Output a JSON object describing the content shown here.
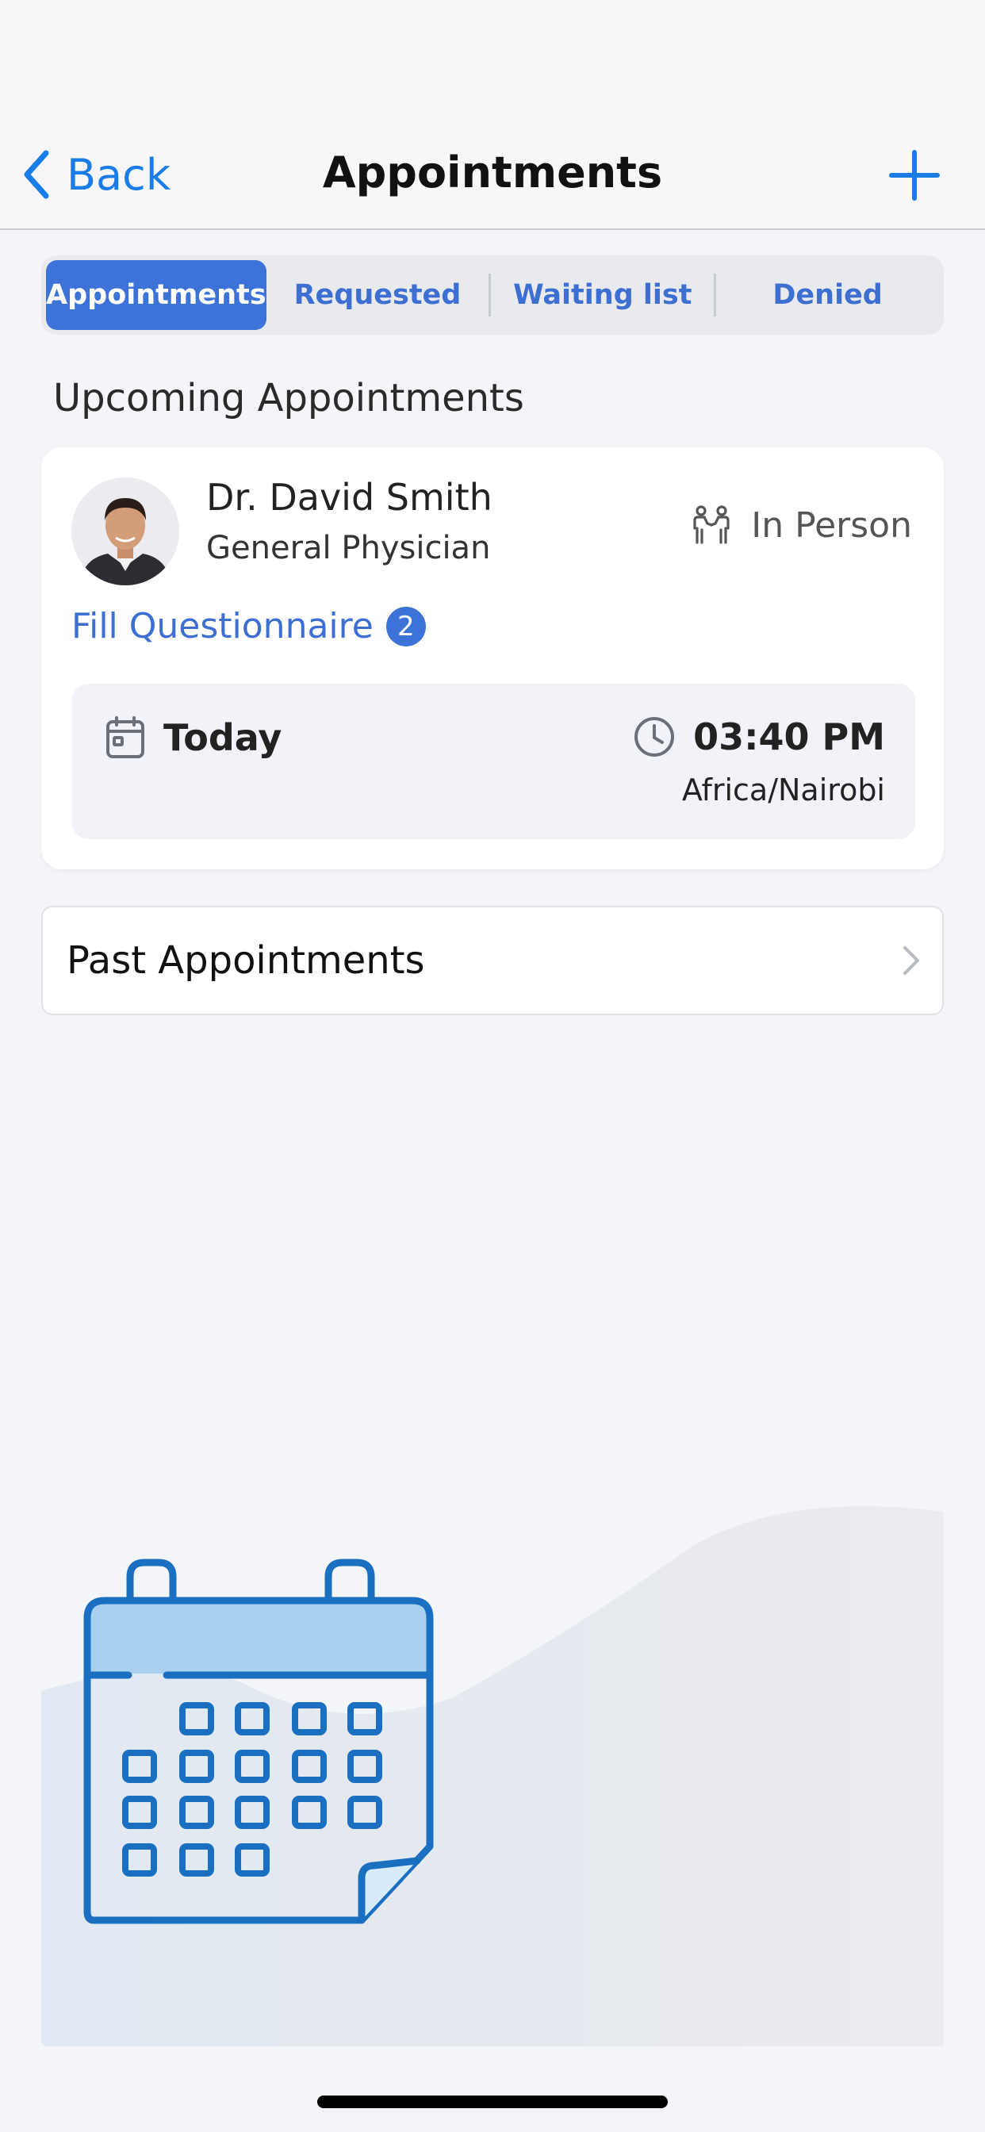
{
  "nav": {
    "back_label": "Back",
    "title": "Appointments"
  },
  "tabs": [
    {
      "label": "Appointments",
      "active": true
    },
    {
      "label": "Requested",
      "active": false
    },
    {
      "label": "Waiting list",
      "active": false
    },
    {
      "label": "Denied",
      "active": false
    }
  ],
  "upcoming": {
    "title": "Upcoming Appointments",
    "card": {
      "doctor_name": "Dr. David Smith",
      "specialty": "General Physician",
      "visit_type": "In Person",
      "questionnaire_label": "Fill Questionnaire",
      "questionnaire_count": "2",
      "date": "Today",
      "time": "03:40 PM",
      "timezone": "Africa/Nairobi"
    }
  },
  "past": {
    "label": "Past Appointments"
  },
  "colors": {
    "accent": "#1a7ce6",
    "tab_active": "#3d73d8",
    "link": "#3c6fd1",
    "background": "#f4f5f8"
  },
  "icons": {
    "back": "chevron-left-icon",
    "add": "plus-icon",
    "visit_type": "people-icon",
    "date": "calendar-icon",
    "time": "clock-icon",
    "past": "chevron-right-icon"
  }
}
